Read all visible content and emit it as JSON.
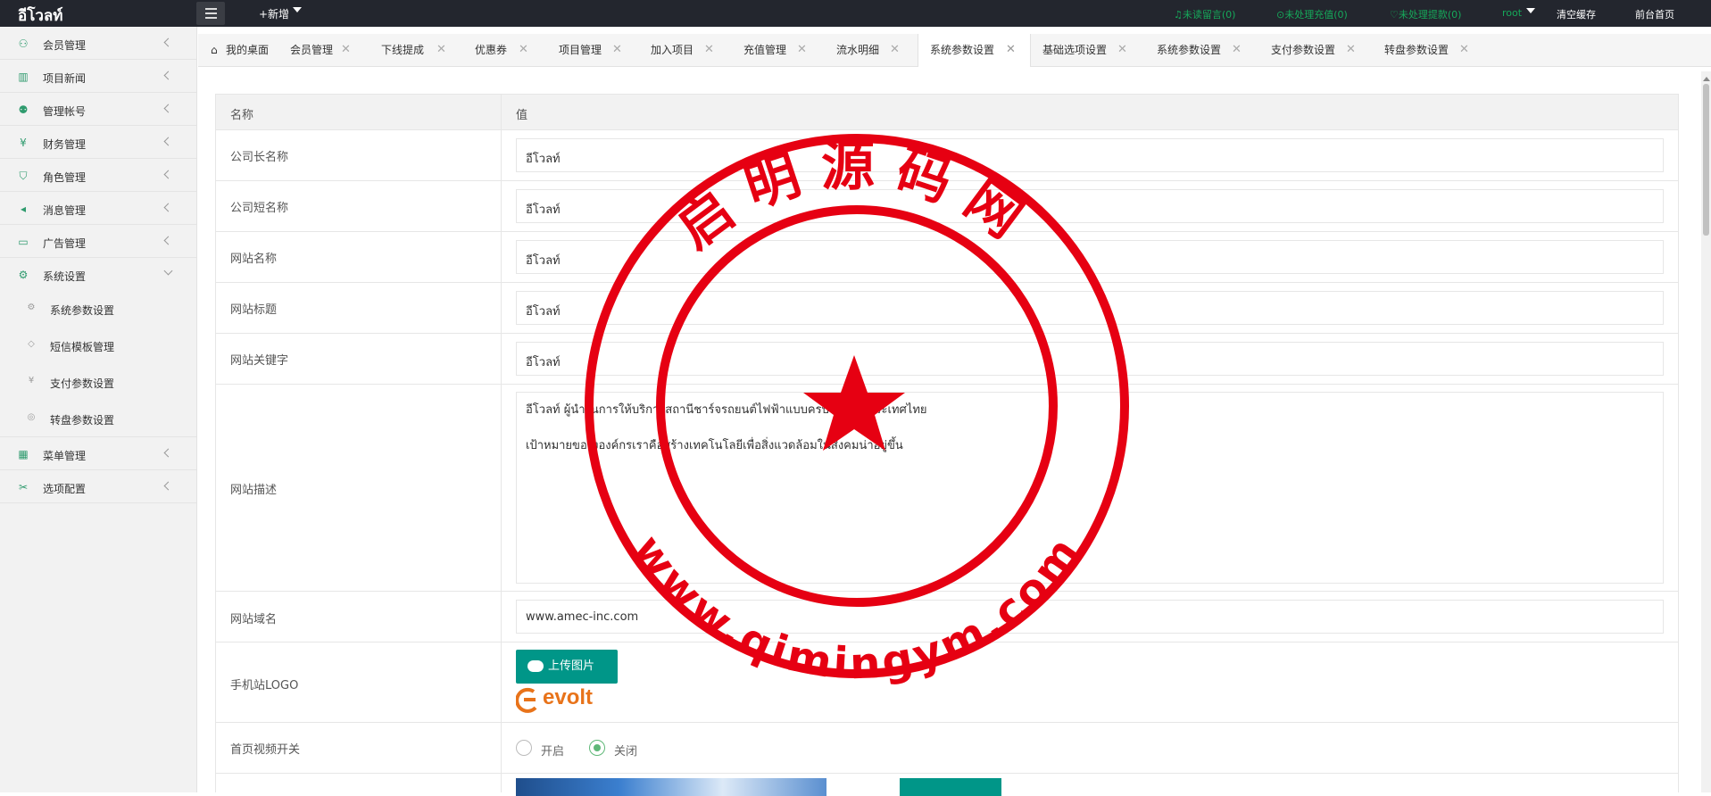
{
  "app": {
    "logo": "อีโวลท์",
    "new_label": "+新增"
  },
  "topnav": {
    "unread": "未读留言(0)",
    "unprocessed_recharge": "未处理充值(0)",
    "unprocessed_withdraw": "未处理提款(0)",
    "user": "root",
    "clear_cache": "清空缓存",
    "frontend_home": "前台首页"
  },
  "sidebar": {
    "items": [
      {
        "label": "会员管理",
        "icon": "user-icon"
      },
      {
        "label": "项目新闻",
        "icon": "book-icon"
      },
      {
        "label": "管理帐号",
        "icon": "account-icon"
      },
      {
        "label": "财务管理",
        "icon": "finance-icon"
      },
      {
        "label": "角色管理",
        "icon": "shield-icon"
      },
      {
        "label": "消息管理",
        "icon": "speaker-icon"
      },
      {
        "label": "广告管理",
        "icon": "ad-icon"
      },
      {
        "label": "系统设置",
        "icon": "gear-icon"
      }
    ],
    "sub_items": [
      {
        "label": "系统参数设置",
        "icon": "gear-icon"
      },
      {
        "label": "短信模板管理",
        "icon": "tag-icon"
      },
      {
        "label": "支付参数设置",
        "icon": "yen-icon"
      },
      {
        "label": "转盘参数设置",
        "icon": "wheel-icon"
      }
    ],
    "items_after": [
      {
        "label": "菜单管理",
        "icon": "grid-icon"
      },
      {
        "label": "选项配置",
        "icon": "tools-icon"
      }
    ]
  },
  "tabs": [
    {
      "label": "我的桌面",
      "closable": false,
      "icon": "home-icon"
    },
    {
      "label": "会员管理",
      "closable": true
    },
    {
      "label": "下线提成",
      "closable": true
    },
    {
      "label": "优惠券",
      "closable": true
    },
    {
      "label": "项目管理",
      "closable": true
    },
    {
      "label": "加入项目",
      "closable": true
    },
    {
      "label": "充值管理",
      "closable": true
    },
    {
      "label": "流水明细",
      "closable": true
    },
    {
      "label": "系统参数设置",
      "closable": true,
      "active": true
    },
    {
      "label": "基础选项设置",
      "closable": true
    },
    {
      "label": "系统参数设置",
      "closable": true
    },
    {
      "label": "支付参数设置",
      "closable": true
    },
    {
      "label": "转盘参数设置",
      "closable": true
    }
  ],
  "tab_close_glyph": "✕",
  "table": {
    "col_name": "名称",
    "col_value": "值",
    "rows": [
      {
        "name": "公司长名称",
        "value": "อีโวลท์"
      },
      {
        "name": "公司短名称",
        "value": "อีโวลท์"
      },
      {
        "name": "网站名称",
        "value": "อีโวลท์"
      },
      {
        "name": "网站标题",
        "value": "อีโวลท์"
      },
      {
        "name": "网站关键字",
        "value": "อีโวลท์"
      },
      {
        "name": "网站描述",
        "value": "อีโวลท์ ผู้นำในการให้บริการสถานีชาร์จรถยนต์ไฟฟ้าแบบครบวงจรในประเทศไทย\n\nเป้าหมายของงองค์กรเราคือสร้างเทคโนโลยีเพื่อสิ่งแวดล้อมในสังคมน่าอยู่ขึ้น"
      },
      {
        "name": "网站域名",
        "value": "www.amec-inc.com"
      },
      {
        "name": "手机站LOGO",
        "upload_label": "上传图片",
        "logo_text": "evolt"
      },
      {
        "name": "首页视频开关",
        "option_on": "开启",
        "option_off": "关闭",
        "selected": "关闭"
      }
    ]
  },
  "watermark": {
    "top_text": "启明源码网",
    "bottom_text": "www.qimingym.com",
    "color": "#e60012"
  },
  "colors": {
    "accent": "#009688",
    "topbar": "#23262e",
    "sidebar_icon": "#2f9b6e",
    "status_green": "#16a85a"
  }
}
